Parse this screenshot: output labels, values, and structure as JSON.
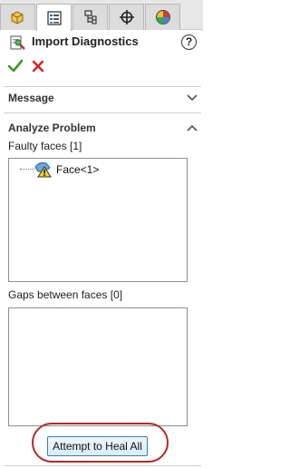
{
  "tabs": [
    {
      "icon": "feature-manager-icon",
      "active": false
    },
    {
      "icon": "property-manager-icon",
      "active": true
    },
    {
      "icon": "configuration-manager-icon",
      "active": false
    },
    {
      "icon": "dimxpert-icon",
      "active": false
    },
    {
      "icon": "display-manager-icon",
      "active": false
    }
  ],
  "header": {
    "title": "Import Diagnostics",
    "help_icon_glyph": "?"
  },
  "sections": {
    "message": {
      "title": "Message"
    },
    "analyze": {
      "title": "Analyze Problem",
      "faulty_faces_label": "Faulty faces [1]",
      "faulty_faces": [
        {
          "label": "Face<1>",
          "icon": "face-warning-icon"
        }
      ],
      "gaps_label": "Gaps between faces [0]",
      "gaps": []
    }
  },
  "actions": {
    "heal_label": "Attempt to Heal All"
  },
  "colors": {
    "ok_green": "#3a9a2a",
    "cancel_red": "#d42020",
    "highlight_ring": "#b02a2a",
    "button_border": "#3c7fb1"
  }
}
